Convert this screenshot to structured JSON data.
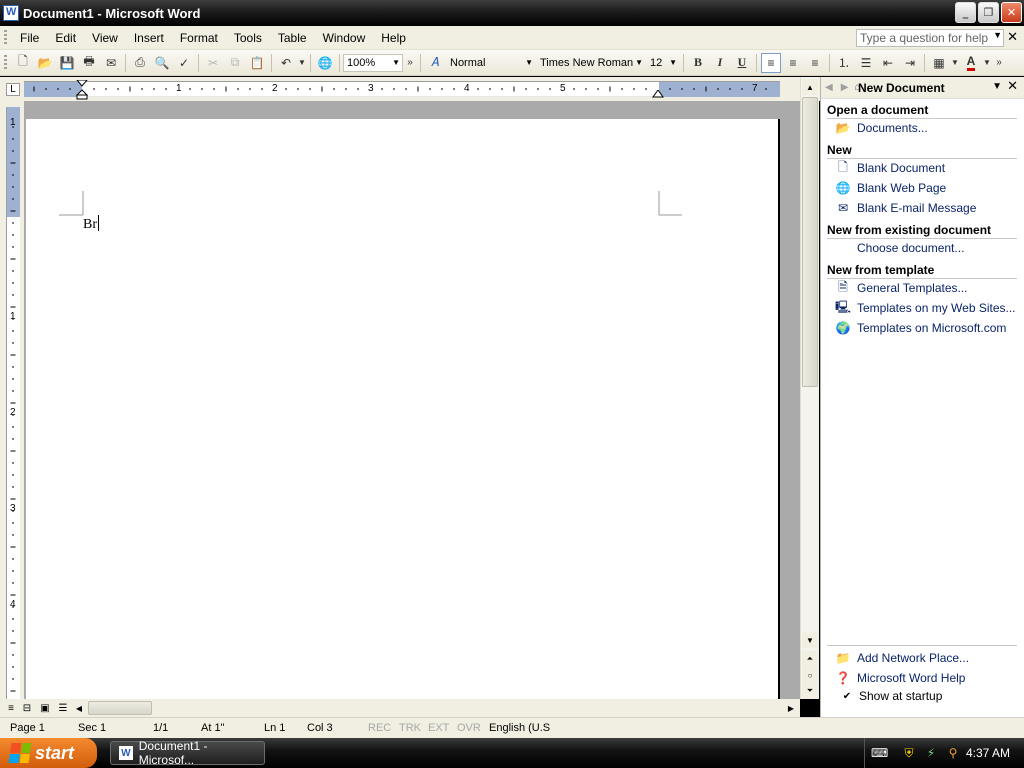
{
  "window": {
    "title": "Document1 - Microsoft Word"
  },
  "menu": {
    "items": [
      "File",
      "Edit",
      "View",
      "Insert",
      "Format",
      "Tools",
      "Table",
      "Window",
      "Help"
    ],
    "help_placeholder": "Type a question for help"
  },
  "toolbar": {
    "zoom": "100%",
    "style": "Normal",
    "font": "Times New Roman",
    "size": "12",
    "bold_label": "B",
    "italic_label": "I",
    "underline_label": "U",
    "font_color_label": "A",
    "font_color": "#d40000"
  },
  "ruler": {
    "numbers": [
      "1",
      "2",
      "3",
      "4",
      "5",
      "7"
    ],
    "vnumbers": [
      "1",
      "1",
      "2",
      "3",
      "4"
    ]
  },
  "document": {
    "text": "Br"
  },
  "statusbar": {
    "page": "Page 1",
    "sec": "Sec 1",
    "pages": "1/1",
    "at": "At 1\"",
    "ln": "Ln 1",
    "col": "Col 3",
    "rec": "REC",
    "trk": "TRK",
    "ext": "EXT",
    "ovr": "OVR",
    "language": "English (U.S"
  },
  "taskpane": {
    "title": "New Document",
    "sections": {
      "open": "Open a document",
      "new": "New",
      "existing": "New from existing document",
      "template": "New from template"
    },
    "links": {
      "documents": "Documents...",
      "blank_document": "Blank Document",
      "blank_web_page": "Blank Web Page",
      "blank_email": "Blank E-mail Message",
      "choose_document": "Choose document...",
      "general_templates": "General Templates...",
      "web_site_templates": "Templates on my Web Sites...",
      "ms_templates": "Templates on Microsoft.com",
      "add_network_place": "Add Network Place...",
      "word_help": "Microsoft Word Help"
    },
    "show_at_startup": "Show at startup",
    "show_at_startup_checked": true
  },
  "taskbar": {
    "start_label": "start",
    "task_label": "Document1 - Microsof...",
    "time": "4:37 AM"
  }
}
